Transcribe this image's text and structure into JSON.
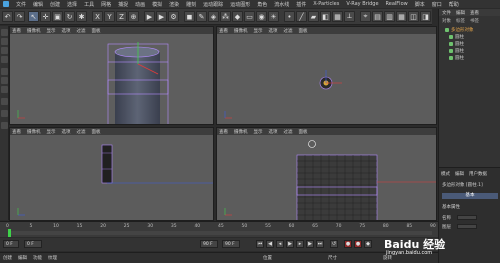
{
  "menubar": {
    "items": [
      "文件",
      "编辑",
      "创建",
      "选择",
      "工具",
      "网格",
      "捕捉",
      "动画",
      "模拟",
      "渲染",
      "雕刻",
      "运动跟踪",
      "运动图形",
      "角色",
      "流水线",
      "插件",
      "X-Particles",
      "V-Ray Bridge",
      "RealFlow",
      "脚本",
      "窗口",
      "帮助"
    ]
  },
  "toolbar": {
    "axis_buttons": [
      "X",
      "Y",
      "Z"
    ],
    "colors": {
      "active": "#5b6e8a",
      "button": "#4a4a4a"
    }
  },
  "viewports": {
    "menu": [
      "查看",
      "摄像机",
      "显示",
      "选项",
      "过滤",
      "面板"
    ],
    "perspective": {
      "label": "透视视图"
    },
    "top": {
      "label": "顶视图"
    },
    "right": {
      "label": "右视图"
    },
    "front": {
      "label": "正视图"
    }
  },
  "right_panel": {
    "tabs": [
      "文件",
      "编辑",
      "查看",
      "对象",
      "标签",
      "书签"
    ],
    "objects": [
      {
        "name": "多边形对象"
      },
      {
        "name": "圆柱"
      },
      {
        "name": "圆柱"
      },
      {
        "name": "圆柱"
      },
      {
        "name": "圆柱"
      }
    ],
    "attr_tabs": [
      "模式",
      "编辑",
      "用户数据"
    ],
    "attr_object": "多边形对象 [圆柱.1]",
    "basic_button": "基本",
    "attr_section": "基本属性",
    "attr_fields": [
      "名称",
      "图层"
    ]
  },
  "timeline": {
    "ticks": [
      "0",
      "5",
      "10",
      "15",
      "20",
      "25",
      "30",
      "35",
      "40",
      "45",
      "50",
      "55",
      "60",
      "65",
      "70",
      "75",
      "80",
      "85",
      "90"
    ]
  },
  "transport": {
    "start_frame": "0 F",
    "current_frame": "0 F",
    "end_frame": "90 F",
    "end_frame2": "90 F"
  },
  "bottombar": {
    "items": [
      "创建",
      "编辑",
      "功能",
      "纹理",
      "位置",
      "尺寸",
      "旋转"
    ]
  },
  "watermark": {
    "text": "Baidu 经验",
    "url": "jingyan.baidu.com"
  }
}
